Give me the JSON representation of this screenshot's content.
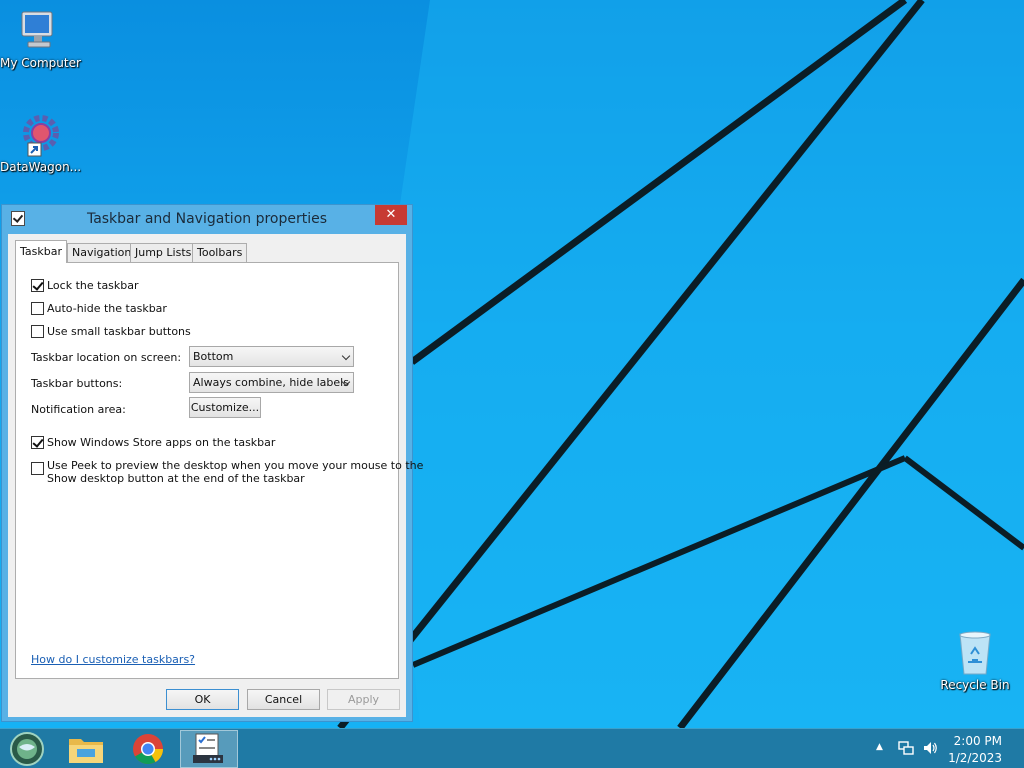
{
  "desktop": {
    "icons": [
      {
        "label": "My Computer",
        "icon": "computer-icon"
      },
      {
        "label": "DataWagon...",
        "icon": "gear-icon"
      },
      {
        "label": "Recycle Bin",
        "icon": "recycle-bin-icon"
      }
    ]
  },
  "dialog": {
    "title": "Taskbar and Navigation properties",
    "close_glyph": "✕",
    "tabs": [
      {
        "label": "Taskbar",
        "active": true
      },
      {
        "label": "Navigation",
        "active": false
      },
      {
        "label": "Jump Lists",
        "active": false
      },
      {
        "label": "Toolbars",
        "active": false
      }
    ],
    "checkboxes": {
      "lock": {
        "label": "Lock the taskbar",
        "checked": true
      },
      "autohide": {
        "label": "Auto-hide the taskbar",
        "checked": false
      },
      "small": {
        "label": "Use small taskbar buttons",
        "checked": false
      },
      "store": {
        "label": "Show Windows Store apps on the taskbar",
        "checked": true
      },
      "peek": {
        "line1": "Use Peek to preview the desktop when you move your mouse to the",
        "line2": "Show desktop button at the end of the taskbar",
        "checked": false
      }
    },
    "location": {
      "label": "Taskbar location on screen:",
      "value": "Bottom"
    },
    "buttons_setting": {
      "label": "Taskbar buttons:",
      "value": "Always combine, hide labels"
    },
    "notification": {
      "label": "Notification area:",
      "button": "Customize..."
    },
    "help_link": "How do I customize taskbars?",
    "ok": "OK",
    "cancel": "Cancel",
    "apply": "Apply"
  },
  "taskbar": {
    "items": [
      {
        "name": "start-button",
        "icon": "start-orb-icon"
      },
      {
        "name": "file-explorer",
        "icon": "folder-icon"
      },
      {
        "name": "chrome",
        "icon": "chrome-icon"
      },
      {
        "name": "taskbar-properties",
        "icon": "checklist-icon",
        "active": true
      }
    ],
    "time": "2:00 PM",
    "date": "1/2/2023",
    "tray_icons": [
      "chevron-up-icon",
      "network-icon",
      "volume-icon"
    ]
  }
}
